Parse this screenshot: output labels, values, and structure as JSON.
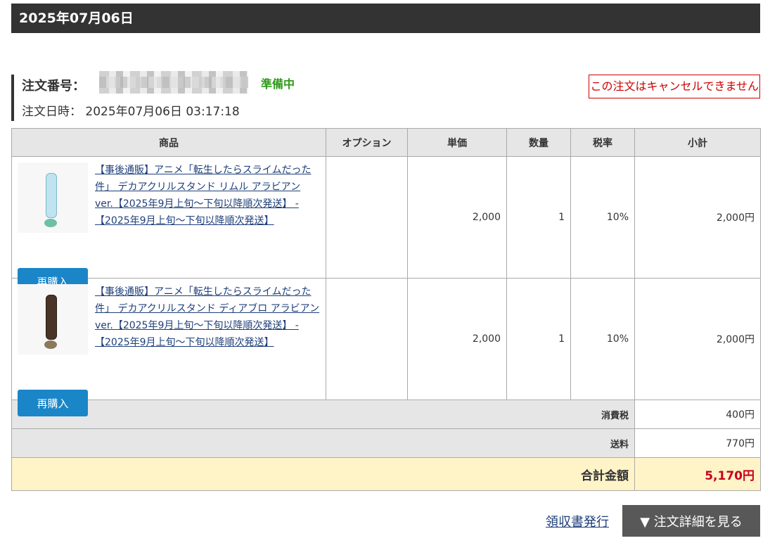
{
  "header": {
    "date": "2025年07月06日"
  },
  "order": {
    "number_label": "注文番号：",
    "status": "準備中",
    "date_text": "注文日時： 2025年07月06日 03:17:18",
    "cancel_note": "この注文はキャンセルできません"
  },
  "table": {
    "headers": [
      "商品",
      "オプション",
      "単価",
      "数量",
      "税率",
      "小計"
    ],
    "items": [
      {
        "title": "【事後通販】アニメ「転生したらスライムだった件」 デカアクリルスタンド リムル アラビアン ver.【2025年9月上旬～下旬以降順次発送】 - 【2025年9月上旬～下旬以降順次発送】",
        "option": "",
        "unit_price": "2,000",
        "quantity": "1",
        "tax_rate": "10%",
        "subtotal": "2,000円",
        "rebuy_label": "再購入"
      },
      {
        "title": "【事後通販】アニメ「転生したらスライムだった件」 デカアクリルスタンド ディアブロ アラビアン ver.【2025年9月上旬～下旬以降順次発送】 - 【2025年9月上旬～下旬以降順次発送】",
        "option": "",
        "unit_price": "2,000",
        "quantity": "1",
        "tax_rate": "10%",
        "subtotal": "2,000円",
        "rebuy_label": "再購入"
      }
    ],
    "tax_label": "消費税",
    "tax_value": "400円",
    "shipping_label": "送料",
    "shipping_value": "770円",
    "total_label": "合計金額",
    "total_value": "5,170円"
  },
  "footer": {
    "receipt_link": "領収書発行",
    "detail_button": "▼ 注文詳細を見る"
  },
  "colors": {
    "status_green": "#2e9a1a",
    "cancel_red": "#d00000",
    "rebuy_blue": "#1a86c8",
    "total_red": "#c8001e",
    "total_bg": "#fff3c8"
  }
}
